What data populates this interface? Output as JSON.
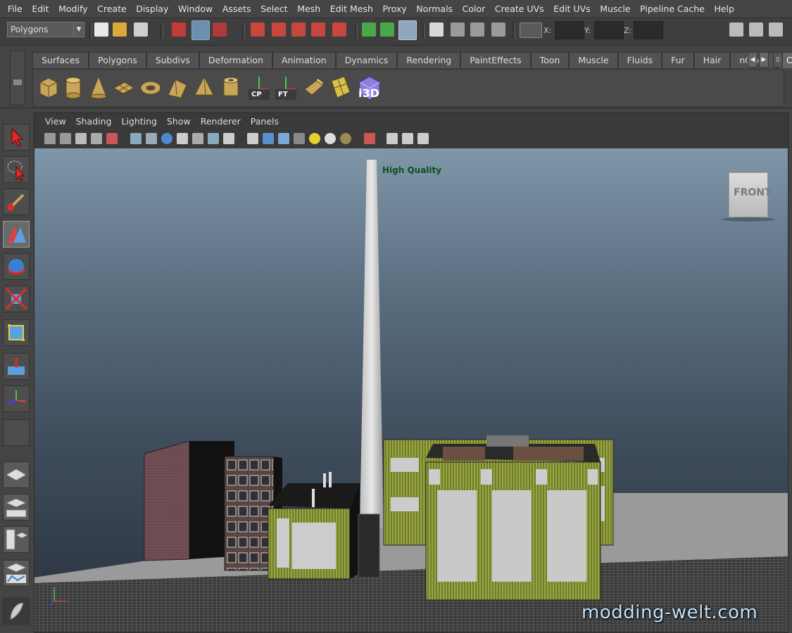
{
  "menubar": {
    "items": [
      "File",
      "Edit",
      "Modify",
      "Create",
      "Display",
      "Window",
      "Assets",
      "Select",
      "Mesh",
      "Edit Mesh",
      "Proxy",
      "Normals",
      "Color",
      "Create UVs",
      "Edit UVs",
      "Muscle",
      "Pipeline Cache",
      "Help"
    ]
  },
  "statusline": {
    "mode": "Polygons",
    "coord_x": "X:",
    "coord_y": "Y:",
    "coord_z": "Z:"
  },
  "shelf": {
    "tabs": [
      "Surfaces",
      "Polygons",
      "Subdivs",
      "Deformation",
      "Animation",
      "Dynamics",
      "Rendering",
      "PaintEffects",
      "Toon",
      "Muscle",
      "Fluids",
      "Fur",
      "Hair",
      "nCloth",
      "Custom"
    ],
    "active_tab": "Custom",
    "icon_labels": {
      "cp": "CP",
      "ft": "FT",
      "i3d": "i3D"
    }
  },
  "panel": {
    "menu": [
      "View",
      "Shading",
      "Lighting",
      "Show",
      "Renderer",
      "Panels"
    ]
  },
  "viewport": {
    "quality_label": "High Quality",
    "viewcube_label": "FRONT"
  },
  "watermark": "modding-welt.com"
}
